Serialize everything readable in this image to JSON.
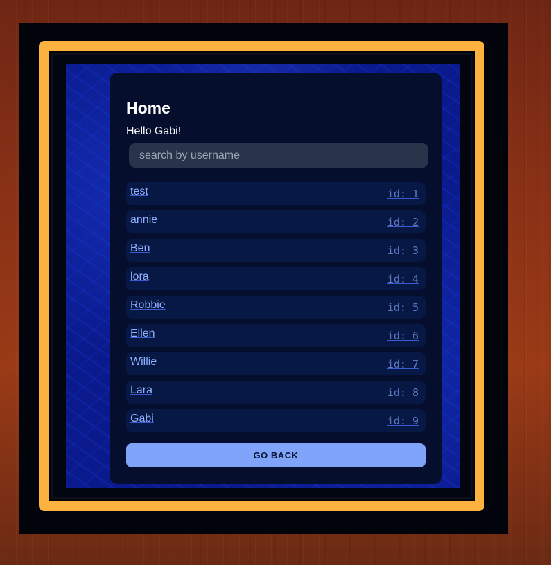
{
  "page": {
    "title": "Home",
    "greeting": "Hello Gabi!"
  },
  "search": {
    "placeholder": "search by username",
    "value": ""
  },
  "users": [
    {
      "name": "test",
      "id": "id: 1"
    },
    {
      "name": "annie",
      "id": "id: 2"
    },
    {
      "name": "Ben",
      "id": "id: 3"
    },
    {
      "name": "lora",
      "id": "id: 4"
    },
    {
      "name": "Robbie",
      "id": "id: 5"
    },
    {
      "name": "Ellen",
      "id": "id: 6"
    },
    {
      "name": "Willie",
      "id": "id: 7"
    },
    {
      "name": "Lara",
      "id": "id: 8"
    },
    {
      "name": "Gabi",
      "id": "id: 9"
    }
  ],
  "actions": {
    "back_label": "GO BACK"
  },
  "colors": {
    "frame_gold": "#fdb23f",
    "card_background": "#050e2c",
    "button_background": "#7fa4fa",
    "link_text": "#8fb0ff"
  }
}
